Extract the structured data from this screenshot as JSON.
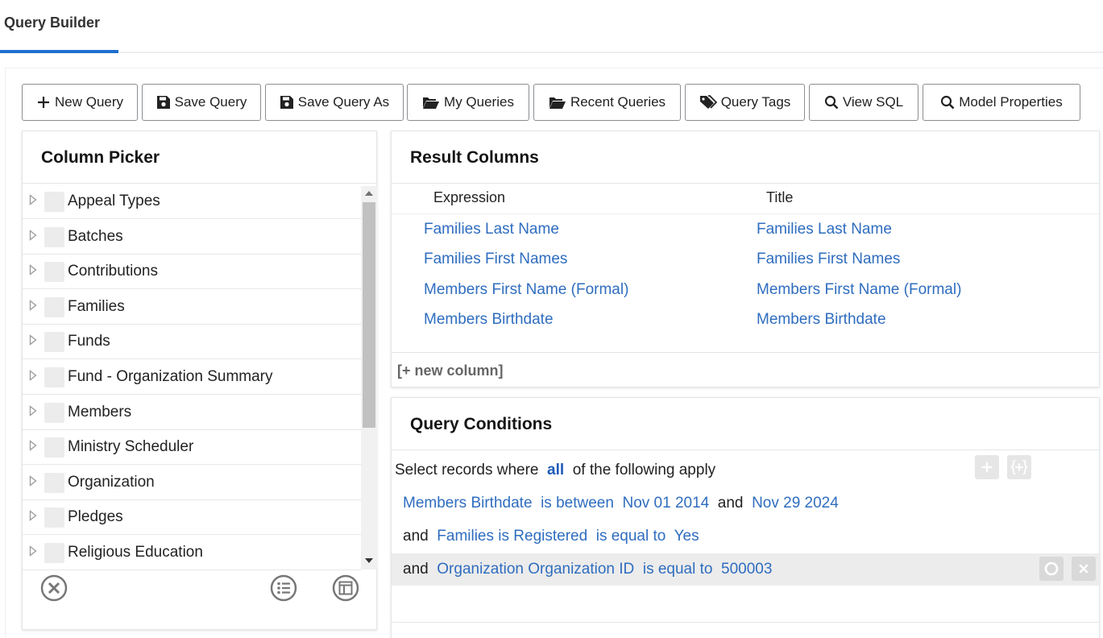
{
  "tabs": [
    {
      "label": "Query Builder"
    }
  ],
  "toolbar": {
    "new_query": "New Query",
    "save_query": "Save Query",
    "save_query_as": "Save Query As",
    "my_queries": "My Queries",
    "recent_queries": "Recent Queries",
    "query_tags": "Query Tags",
    "view_sql": "View SQL",
    "model_properties": "Model Properties"
  },
  "column_picker": {
    "title": "Column Picker",
    "items": [
      {
        "label": "Appeal Types"
      },
      {
        "label": "Batches"
      },
      {
        "label": "Contributions"
      },
      {
        "label": "Families"
      },
      {
        "label": "Funds"
      },
      {
        "label": "Fund - Organization Summary"
      },
      {
        "label": "Members"
      },
      {
        "label": "Ministry Scheduler"
      },
      {
        "label": "Organization"
      },
      {
        "label": "Pledges"
      },
      {
        "label": "Religious Education"
      }
    ]
  },
  "result_columns": {
    "title": "Result Columns",
    "headers": {
      "expression": "Expression",
      "title": "Title"
    },
    "rows": [
      {
        "expression": "Families Last Name",
        "title": "Families Last Name"
      },
      {
        "expression": "Families First Names",
        "title": "Families First Names"
      },
      {
        "expression": "Members First Name (Formal)",
        "title": "Members First Name (Formal)"
      },
      {
        "expression": "Members Birthdate",
        "title": "Members Birthdate"
      }
    ],
    "new_column": "[+ new column]"
  },
  "query_conditions": {
    "title": "Query Conditions",
    "intro_prefix": "Select records where",
    "intro_match": "all",
    "intro_suffix": "of the following apply",
    "conditions": [
      {
        "connector": "",
        "field": "Members Birthdate",
        "operator": "is between",
        "value": "Nov 01 2014",
        "joiner": "and",
        "value2": "Nov 29 2024"
      },
      {
        "connector": "and",
        "field": "Families is Registered",
        "operator": "is equal to",
        "value": "Yes"
      },
      {
        "connector": "and",
        "field": "Organization Organization ID",
        "operator": "is equal to",
        "value": "500003"
      }
    ]
  },
  "colors": {
    "accent": "#1f6fcf",
    "link": "#2f6dbf",
    "highlight_row": "#ececec"
  }
}
